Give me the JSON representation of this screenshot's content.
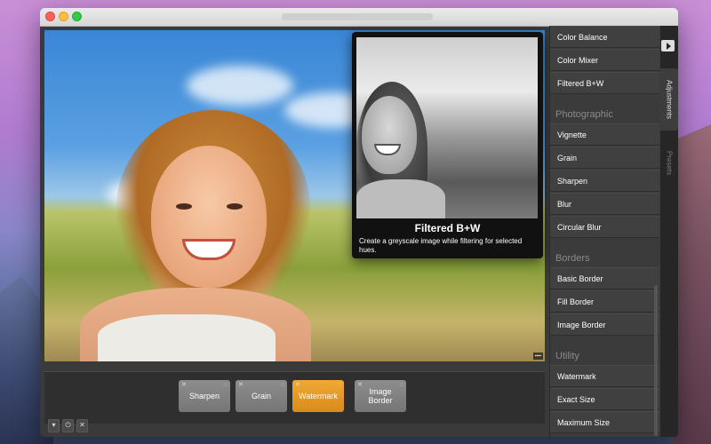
{
  "popover": {
    "title": "Filtered B+W",
    "description": "Create a greyscale image while filtering for selected hues."
  },
  "filter_strip": {
    "cards": [
      {
        "label": "Sharpen",
        "active": false
      },
      {
        "label": "Grain",
        "active": false
      },
      {
        "label": "Watermark",
        "active": true
      },
      {
        "label": "Image Border",
        "active": false
      }
    ]
  },
  "panel": {
    "items_top": [
      "Color Balance",
      "Color Mixer",
      "Filtered B+W"
    ],
    "section_photographic": "Photographic",
    "items_photographic": [
      "Vignette",
      "Grain",
      "Sharpen",
      "Blur",
      "Circular Blur"
    ],
    "section_borders": "Borders",
    "items_borders": [
      "Basic Border",
      "Fill Border",
      "Image Border"
    ],
    "section_utility": "Utility",
    "items_utility": [
      "Watermark",
      "Exact Size",
      "Maximum Size"
    ]
  },
  "tabs": {
    "adjustments": "Adjustments",
    "presets": "Presets"
  },
  "colors": {
    "accent": "#e89a26",
    "panel_bg": "#3b3b3b"
  }
}
